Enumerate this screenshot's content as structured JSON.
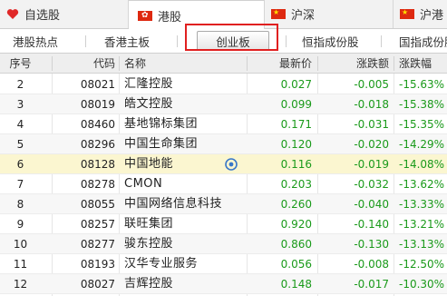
{
  "top_tabs": [
    {
      "label": "自选股",
      "icon": "heart-icon"
    },
    {
      "label": "港股",
      "icon": "hk-flag-icon"
    },
    {
      "label": "沪深",
      "icon": "cn-flag-icon"
    },
    {
      "label": "沪港",
      "icon": "cn-flag-icon"
    }
  ],
  "sub_tabs": [
    {
      "label": "港股热点"
    },
    {
      "label": "香港主板"
    },
    {
      "label": "创业板"
    },
    {
      "label": "恒指成份股"
    },
    {
      "label": "国指成份股"
    }
  ],
  "columns": {
    "seq": "序号",
    "code": "代码",
    "name": "名称",
    "price": "最新价",
    "change": "涨跌额",
    "pct": "涨跌幅"
  },
  "rows": [
    {
      "seq": "2",
      "code": "08021",
      "name": "汇隆控股",
      "price": "0.027",
      "change": "-0.005",
      "pct": "-15.63%"
    },
    {
      "seq": "3",
      "code": "08019",
      "name": "皓文控股",
      "price": "0.099",
      "change": "-0.018",
      "pct": "-15.38%"
    },
    {
      "seq": "4",
      "code": "08460",
      "name": "基地锦标集团",
      "price": "0.171",
      "change": "-0.031",
      "pct": "-15.35%"
    },
    {
      "seq": "5",
      "code": "08296",
      "name": "中国生命集团",
      "price": "0.120",
      "change": "-0.020",
      "pct": "-14.29%"
    },
    {
      "seq": "6",
      "code": "08128",
      "name": "中国地能",
      "price": "0.116",
      "change": "-0.019",
      "pct": "-14.08%"
    },
    {
      "seq": "7",
      "code": "08278",
      "name": "CMON",
      "price": "0.203",
      "change": "-0.032",
      "pct": "-13.62%"
    },
    {
      "seq": "8",
      "code": "08055",
      "name": "中国网络信息科技",
      "price": "0.260",
      "change": "-0.040",
      "pct": "-13.33%"
    },
    {
      "seq": "9",
      "code": "08257",
      "name": "联旺集团",
      "price": "0.920",
      "change": "-0.140",
      "pct": "-13.21%"
    },
    {
      "seq": "10",
      "code": "08277",
      "name": "骏东控股",
      "price": "0.860",
      "change": "-0.130",
      "pct": "-13.13%"
    },
    {
      "seq": "11",
      "code": "08193",
      "name": "汉华专业服务",
      "price": "0.056",
      "change": "-0.008",
      "pct": "-12.50%"
    },
    {
      "seq": "12",
      "code": "08027",
      "name": "吉辉控股",
      "price": "0.148",
      "change": "-0.017",
      "pct": "-10.30%"
    }
  ],
  "colors": {
    "down": "#1a9a1a",
    "highlight_box": "#e02020",
    "selected_row": "#fbf6d0",
    "heart": "#e02828",
    "eye_icon": "#3a78c8"
  }
}
